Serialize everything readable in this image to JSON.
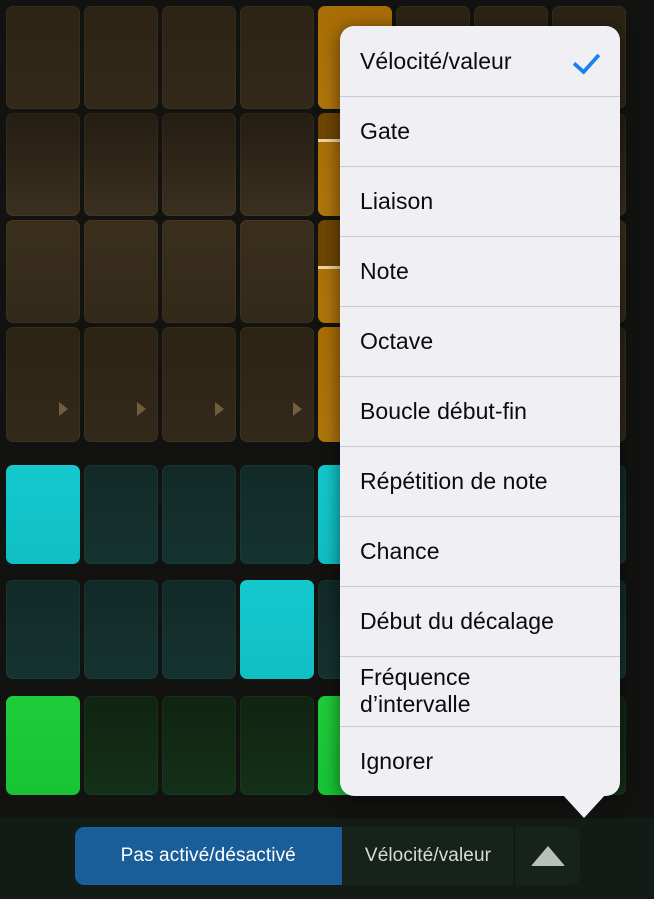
{
  "app": {
    "background_color": "#121210"
  },
  "sequencer": {
    "columns": 8,
    "groups": [
      {
        "name": "velocity-brown-group",
        "color_on": "#b0760c",
        "color_off": "#33291a",
        "rows": [
          {
            "name": "row-1",
            "cells": [
              "off",
              "off",
              "off",
              "off",
              "on",
              "off",
              "off",
              "off"
            ],
            "marker": false
          },
          {
            "name": "row-2",
            "cells": [
              "off",
              "off",
              "off",
              "off",
              "on",
              "off",
              "off",
              "off"
            ],
            "marker": false
          },
          {
            "name": "row-3",
            "cells": [
              "off",
              "off",
              "off",
              "off",
              "on",
              "off",
              "off",
              "off"
            ],
            "marker": false
          },
          {
            "name": "row-4",
            "cells": [
              "off",
              "off",
              "off",
              "off",
              "on",
              "off",
              "off",
              "off"
            ],
            "marker": true
          }
        ]
      },
      {
        "name": "teal-group",
        "color_on": "#12c4c9",
        "color_off": "#153330",
        "rows": [
          {
            "name": "row-5",
            "cells": [
              "on",
              "off",
              "off",
              "off",
              "on",
              "off",
              "off",
              "off"
            ],
            "marker": false
          },
          {
            "name": "row-6",
            "cells": [
              "off",
              "off",
              "off",
              "on",
              "off",
              "off",
              "off",
              "off"
            ],
            "marker": false
          }
        ]
      },
      {
        "name": "green-group",
        "color_on": "#1bc837",
        "color_off": "#143018",
        "rows": [
          {
            "name": "row-7",
            "cells": [
              "on",
              "off",
              "off",
              "off",
              "on",
              "off",
              "off",
              "off"
            ],
            "marker": false
          }
        ]
      }
    ]
  },
  "popover": {
    "name": "edit-mode-menu",
    "background_color": "#f0f0f4",
    "checkmark_color": "#1a82f0",
    "items": [
      {
        "label": "Vélocité/valeur",
        "checked": true
      },
      {
        "label": "Gate",
        "checked": false
      },
      {
        "label": "Liaison",
        "checked": false
      },
      {
        "label": "Note",
        "checked": false
      },
      {
        "label": "Octave",
        "checked": false
      },
      {
        "label": "Boucle début-fin",
        "checked": false
      },
      {
        "label": "Répétition de note",
        "checked": false
      },
      {
        "label": "Chance",
        "checked": false
      },
      {
        "label": "Début du décalage",
        "checked": false
      },
      {
        "label": "Fréquence d’intervalle",
        "checked": false
      },
      {
        "label": "Ignorer",
        "checked": false
      }
    ]
  },
  "toolbar": {
    "background_color": "#121b15",
    "primary_label": "Pas activé/désactivé",
    "primary_color": "#1a5e99",
    "secondary_label": "Vélocité/valeur",
    "arrow_icon": "triangle-up-icon"
  }
}
